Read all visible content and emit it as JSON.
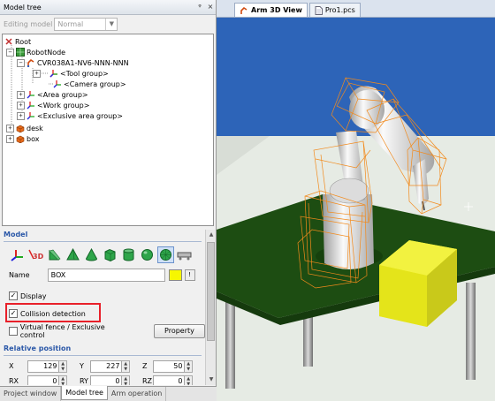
{
  "panel": {
    "title": "Model tree",
    "pin_glyph": "ᵠ",
    "close_glyph": "×",
    "editing_mode_label": "Editing model",
    "editing_mode_value": "Normal"
  },
  "tree": [
    {
      "label": "Root",
      "icon": "root-icon"
    },
    {
      "label": "RobotNode",
      "icon": "robot-node-icon"
    },
    {
      "label": "CVR038A1-NV6-NNN-NNN",
      "icon": "robot-arm-icon"
    },
    {
      "label": "<Tool group>",
      "icon": "axis-icon"
    },
    {
      "label": "<Camera group>",
      "icon": "axis-icon"
    },
    {
      "label": "<Area group>",
      "icon": "axis-icon"
    },
    {
      "label": "<Work group>",
      "icon": "axis-icon"
    },
    {
      "label": "<Exclusive area group>",
      "icon": "axis-icon"
    },
    {
      "label": "desk",
      "icon": "object-icon"
    },
    {
      "label": "box",
      "icon": "object-icon"
    }
  ],
  "model": {
    "section_title": "Model",
    "shape_buttons": [
      "axis-shape-icon",
      "3d-shape-icon",
      "wedge-shape-icon",
      "pyramid-shape-icon",
      "cone-shape-icon",
      "box-shape-icon",
      "cylinder-shape-icon",
      "sphere-shape-icon",
      "mesh-shape-icon",
      "conveyor-shape-icon"
    ],
    "name_label": "Name",
    "name_value": "BOX",
    "color": "#f7f700",
    "color_button_label": "!",
    "display_label": "Display",
    "display_checked": true,
    "collision_label": "Collision detection",
    "collision_checked": true,
    "fence_label": "Virtual fence / Exclusive control",
    "fence_checked": false,
    "property_button": "Property",
    "relpos_title": "Relative position",
    "pos_row1": [
      {
        "axis": "X",
        "value": "129"
      },
      {
        "axis": "Y",
        "value": "227"
      },
      {
        "axis": "Z",
        "value": "50"
      }
    ],
    "pos_row2": [
      {
        "axis": "RX",
        "value": "0"
      },
      {
        "axis": "RY",
        "value": "0"
      },
      {
        "axis": "RZ",
        "value": "0"
      }
    ]
  },
  "bottom_tabs": [
    "Project window",
    "Model tree",
    "Arm operation"
  ],
  "doc_tabs": [
    {
      "label": "Arm 3D View",
      "active": true
    },
    {
      "label": "Pro1.pcs",
      "active": false
    }
  ],
  "colors": {
    "sky": "#2d64b8",
    "floor": "#e6ebe4",
    "table": "#1d4d12",
    "box": "#ecec1a",
    "wireframe": "#f28a1c"
  }
}
